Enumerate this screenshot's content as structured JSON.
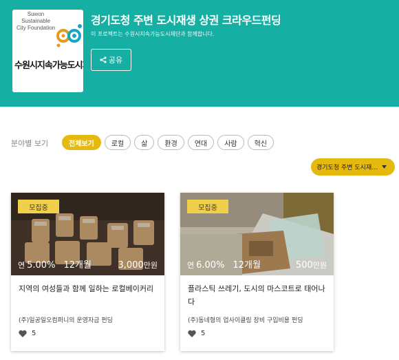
{
  "header": {
    "logo": {
      "text_en_lines": [
        "Suwon",
        "Sustainable",
        "City Foundation"
      ],
      "text_kr": "수원시지속가능도시재단"
    },
    "title": "경기도청 주변 도시재생 상권 크라우드펀딩",
    "subtitle": "이 프로젝트는 수원시지속가능도시재단과 함께합니다.",
    "share_label": "공유",
    "share_icon": "share-icon",
    "background_color": "#16afa4"
  },
  "filter": {
    "label": "분야별 보기",
    "chips": [
      {
        "label": "전체보기",
        "active": true
      },
      {
        "label": "로컬",
        "active": false
      },
      {
        "label": "삶",
        "active": false
      },
      {
        "label": "환경",
        "active": false
      },
      {
        "label": "연대",
        "active": false
      },
      {
        "label": "사람",
        "active": false
      },
      {
        "label": "혁신",
        "active": false
      }
    ],
    "region_select": "경기도청 주변 도시재…",
    "accent_color": "#e5b90e"
  },
  "cards": [
    {
      "badge": "모집중",
      "rate_prefix": "연",
      "rate": "5.00%",
      "term": "12개월",
      "amount": "3,000",
      "amount_unit": "만원",
      "title": "지역의 여성들과 함께 일하는 로컬베이커리",
      "desc": "(주)일공일오컴퍼니의 운영자금 펀딩",
      "likes": "5"
    },
    {
      "badge": "모집중",
      "rate_prefix": "연",
      "rate": "6.00%",
      "term": "12개월",
      "amount": "500",
      "amount_unit": "만원",
      "title": "플라스틱 쓰레기, 도시의 마스코트로 태어나다",
      "desc": "(주)동네형의 업사이클링 장비 구입비용 펀딩",
      "likes": "5"
    }
  ]
}
